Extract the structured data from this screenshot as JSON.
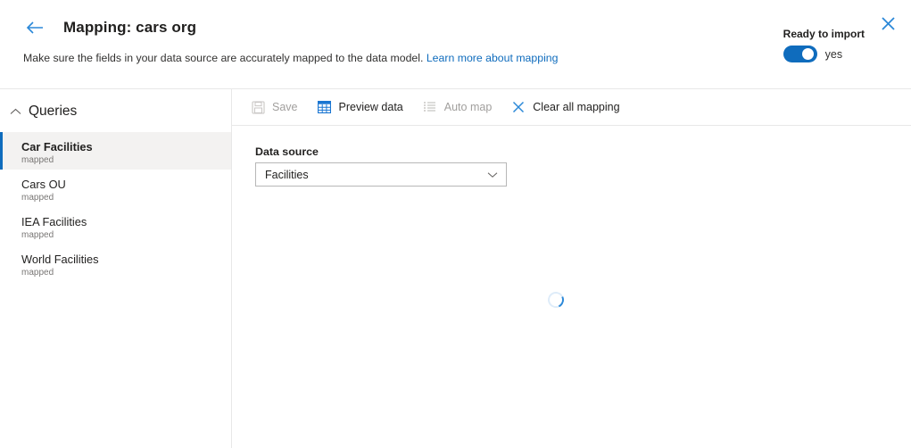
{
  "header": {
    "back_icon": "back-arrow-icon",
    "title": "Mapping: cars org",
    "subtitle_text": "Make sure the fields in your data source are accurately mapped to the data model.",
    "subtitle_link": "Learn more about mapping",
    "ready_label": "Ready to import",
    "toggle_value": "yes",
    "toggle_on": true,
    "close_icon": "close-icon",
    "accent_color": "#0f6cbd",
    "link_color": "#0f6cbd"
  },
  "sidebar": {
    "section_title": "Queries",
    "collapse_icon": "chevron-up-icon",
    "items": [
      {
        "label": "Car Facilities",
        "status": "mapped",
        "selected": true
      },
      {
        "label": "Cars OU",
        "status": "mapped",
        "selected": false
      },
      {
        "label": "IEA Facilities",
        "status": "mapped",
        "selected": false
      },
      {
        "label": "World Facilities",
        "status": "mapped",
        "selected": false
      }
    ]
  },
  "toolbar": {
    "commands": [
      {
        "label": "Save",
        "icon": "save-icon",
        "enabled": false
      },
      {
        "label": "Preview data",
        "icon": "table-grid-icon",
        "enabled": true
      },
      {
        "label": "Auto map",
        "icon": "list-icon",
        "enabled": false
      },
      {
        "label": "Clear all mapping",
        "icon": "clear-x-icon",
        "enabled": true
      }
    ]
  },
  "main": {
    "data_source_label": "Data source",
    "data_source_value": "Facilities",
    "dropdown_icon": "chevron-down-icon",
    "loading": true,
    "spinner_icon": "loading-spinner-icon"
  }
}
